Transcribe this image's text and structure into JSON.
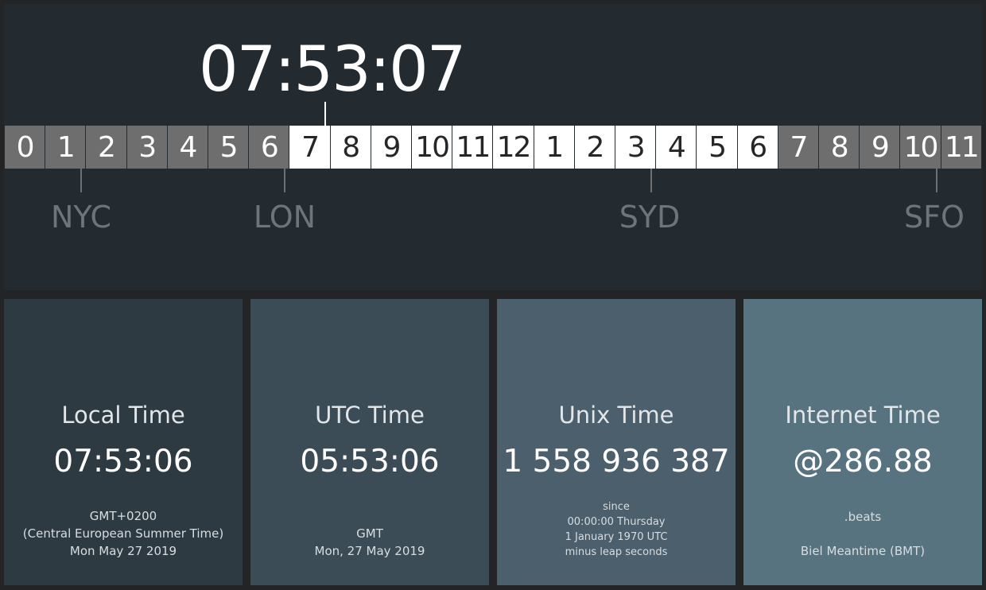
{
  "header": {
    "current_time": "07:53:07"
  },
  "hour_strip": [
    {
      "label": "0",
      "phase": "night"
    },
    {
      "label": "1",
      "phase": "night"
    },
    {
      "label": "2",
      "phase": "night"
    },
    {
      "label": "3",
      "phase": "night"
    },
    {
      "label": "4",
      "phase": "night"
    },
    {
      "label": "5",
      "phase": "night"
    },
    {
      "label": "6",
      "phase": "night"
    },
    {
      "label": "7",
      "phase": "day"
    },
    {
      "label": "8",
      "phase": "day"
    },
    {
      "label": "9",
      "phase": "day"
    },
    {
      "label": "10",
      "phase": "day"
    },
    {
      "label": "11",
      "phase": "day"
    },
    {
      "label": "12",
      "phase": "day"
    },
    {
      "label": "1",
      "phase": "day"
    },
    {
      "label": "2",
      "phase": "day"
    },
    {
      "label": "3",
      "phase": "day"
    },
    {
      "label": "4",
      "phase": "day"
    },
    {
      "label": "5",
      "phase": "day"
    },
    {
      "label": "6",
      "phase": "day"
    },
    {
      "label": "7",
      "phase": "night"
    },
    {
      "label": "8",
      "phase": "night"
    },
    {
      "label": "9",
      "phase": "night"
    },
    {
      "label": "10",
      "phase": "night"
    },
    {
      "label": "11",
      "phase": "night"
    }
  ],
  "cities": {
    "nyc": "NYC",
    "lon": "LON",
    "syd": "SYD",
    "sfo": "SFO"
  },
  "cards": {
    "local": {
      "title": "Local Time",
      "value": "07:53:06",
      "line1": "GMT+0200",
      "line2": "(Central European Summer Time)",
      "line3": "Mon May 27 2019"
    },
    "utc": {
      "title": "UTC Time",
      "value": "05:53:06",
      "line1": "GMT",
      "line2": "Mon, 27 May 2019"
    },
    "unix": {
      "title": "Unix Time",
      "value": "1 558 936 387",
      "line1": "since",
      "line2": "00:00:00 Thursday",
      "line3": "1 January 1970 UTC",
      "line4": "minus leap seconds"
    },
    "internet": {
      "title": "Internet Time",
      "value": "@286.88",
      "line1": ".beats",
      "line2": "Biel Meantime (BMT)"
    }
  },
  "colors": {
    "top_panel": "#232b31",
    "card_local": "#2e3a42",
    "card_utc": "#3b4c56",
    "card_unix": "#4b5f6c",
    "card_internet": "#587380",
    "night_cell": "#6e6e6e",
    "day_cell": "#ffffff"
  }
}
